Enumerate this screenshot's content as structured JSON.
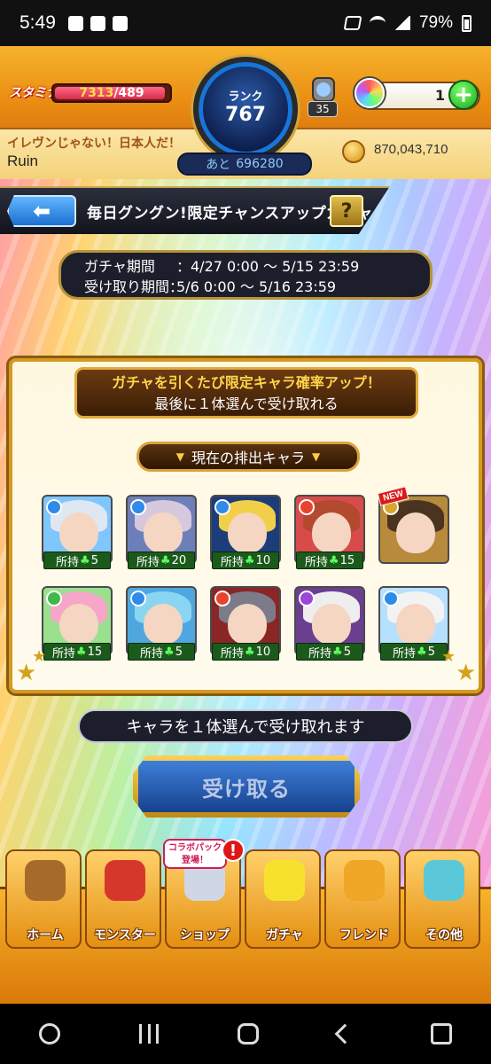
{
  "status_bar": {
    "time": "5:49",
    "battery": "79%"
  },
  "header": {
    "stamina_label": "スタミナ",
    "stamina_current": "7313",
    "stamina_max": "/489",
    "rank_label": "ランク",
    "rank_value": "767",
    "rank_next_prefix": "あと",
    "rank_next_value": "696280",
    "gem_count": "35",
    "orb_count": "1",
    "player_title": "イレヴンじゃない！日本人だ！",
    "player_name": "Ruin",
    "coins": "870,043,710"
  },
  "page": {
    "title": "毎日グングン!限定チャンスアップガチャ",
    "help_label": "?",
    "period_label": "ガチャ期間",
    "period_value": "：4/27 0:00 ～ 5/15 23:59",
    "receive_period_label": "受け取り期間：",
    "receive_period_value": "5/6 0:00 ～ 5/16 23:59"
  },
  "panel": {
    "header_line1": "ガチャを引くたび限定キャラ確率アップ！",
    "header_line2": "最後に１体選んで受け取れる",
    "current_label": "現在の排出キャラ",
    "owned_prefix": "所持",
    "clover": "♣",
    "new_label": "NEW",
    "characters": [
      {
        "owned": "5",
        "element_color": "#2f8be8",
        "hair": "#dfe8f2",
        "bg": "#7fc6ff"
      },
      {
        "owned": "20",
        "element_color": "#2f8be8",
        "hair": "#d7c9dd",
        "bg": "#6d7fb8"
      },
      {
        "owned": "10",
        "element_color": "#2f8be8",
        "hair": "#f2cf48",
        "bg": "#1d3c7a"
      },
      {
        "owned": "15",
        "element_color": "#e8432f",
        "hair": "#b34a2f",
        "bg": "#d94b4b"
      },
      {
        "owned": "",
        "element_color": "#d8a62b",
        "hair": "#4a3320",
        "bg": "#b78a3c",
        "is_new": true
      },
      {
        "owned": "15",
        "element_color": "#3fb94a",
        "hair": "#f6a7c9",
        "bg": "#9be08e"
      },
      {
        "owned": "5",
        "element_color": "#2f8be8",
        "hair": "#8ad6f2",
        "bg": "#4fa7e0"
      },
      {
        "owned": "10",
        "element_color": "#e8432f",
        "hair": "#7b7b8a",
        "bg": "#8a2626"
      },
      {
        "owned": "5",
        "element_color": "#9a47d9",
        "hair": "#eeeeee",
        "bg": "#6a3f8f"
      },
      {
        "owned": "5",
        "element_color": "#2f8be8",
        "hair": "#f3f3f3",
        "bg": "#b6e0ff"
      }
    ]
  },
  "notice": "キャラを１体選んで受け取れます",
  "receive_button": "受け取る",
  "bottom_nav": {
    "collab_badge_line1": "コラボパック",
    "collab_badge_line2": "登場！",
    "alert": "!",
    "items": [
      {
        "label": "ホーム",
        "icon_color": "#a66a2a"
      },
      {
        "label": "モンスター",
        "icon_color": "#d6372b"
      },
      {
        "label": "ショップ",
        "icon_color": "#cfd7e6"
      },
      {
        "label": "ガチャ",
        "icon_color": "#f6e12c"
      },
      {
        "label": "フレンド",
        "icon_color": "#f0a626"
      },
      {
        "label": "その他",
        "icon_color": "#5ac8d8"
      }
    ]
  }
}
